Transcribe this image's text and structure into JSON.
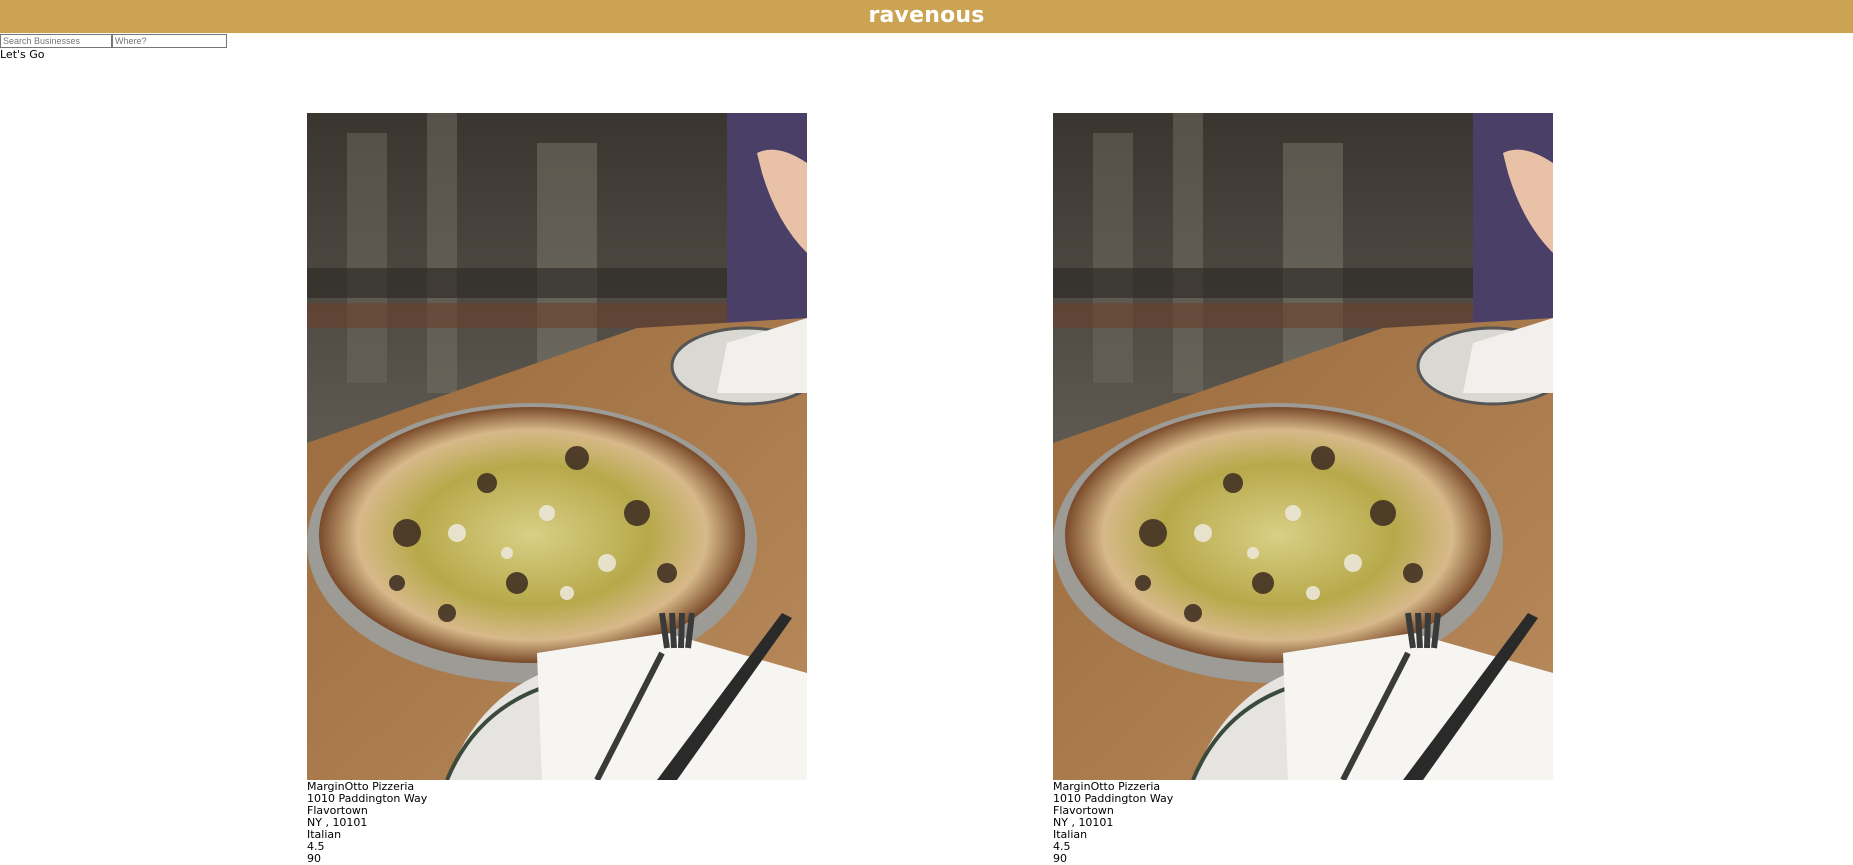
{
  "header": {
    "title": "ravenous",
    "color": "#cca353"
  },
  "search": {
    "term_placeholder": "Search Businesses",
    "location_placeholder": "Where?",
    "submit_label": "Let's Go"
  },
  "businesses": [
    {
      "image": "pizza-photo",
      "name": "MarginOtto Pizzeria",
      "address": "1010 Paddington Way",
      "city": "Flavortown",
      "state_zip": "NY , 10101",
      "category": "Italian",
      "rating": "4.5",
      "review_count": "90"
    },
    {
      "image": "pizza-photo",
      "name": "MarginOtto Pizzeria",
      "address": "1010 Paddington Way",
      "city": "Flavortown",
      "state_zip": "NY , 10101",
      "category": "Italian",
      "rating": "4.5",
      "review_count": "90"
    }
  ]
}
